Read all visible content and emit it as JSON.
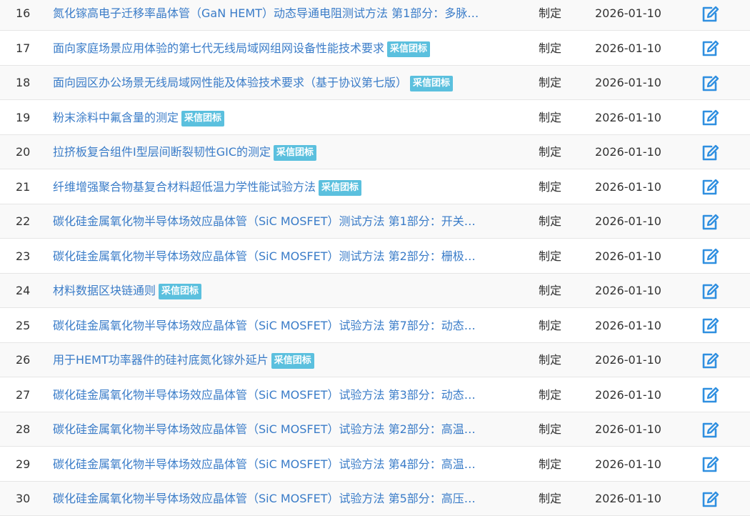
{
  "badge_label": "采信团标",
  "icon": {
    "edit": "edit-icon",
    "color": "#2f8fe0"
  },
  "rows": [
    {
      "num": "16",
      "title": "氮化镓高电子迁移率晶体管（GaN HEMT）动态导通电阻测试方法 第1部分：多脉…",
      "badge": false,
      "type": "制定",
      "date": "2026-01-10"
    },
    {
      "num": "17",
      "title": "面向家庭场景应用体验的第七代无线局域网组网设备性能技术要求",
      "badge": true,
      "type": "制定",
      "date": "2026-01-10"
    },
    {
      "num": "18",
      "title": "面向园区办公场景无线局域网性能及体验技术要求（基于协议第七版）",
      "badge": true,
      "type": "制定",
      "date": "2026-01-10"
    },
    {
      "num": "19",
      "title": "粉末涂料中氟含量的测定",
      "badge": true,
      "type": "制定",
      "date": "2026-01-10"
    },
    {
      "num": "20",
      "title": "拉挤板复合组件I型层间断裂韧性GIC的测定",
      "badge": true,
      "type": "制定",
      "date": "2026-01-10"
    },
    {
      "num": "21",
      "title": "纤维增强聚合物基复合材料超低温力学性能试验方法",
      "badge": true,
      "type": "制定",
      "date": "2026-01-10"
    },
    {
      "num": "22",
      "title": "碳化硅金属氧化物半导体场效应晶体管（SiC MOSFET）测试方法 第1部分：开关…",
      "badge": false,
      "type": "制定",
      "date": "2026-01-10"
    },
    {
      "num": "23",
      "title": "碳化硅金属氧化物半导体场效应晶体管（SiC MOSFET）测试方法 第2部分：栅极…",
      "badge": false,
      "type": "制定",
      "date": "2026-01-10"
    },
    {
      "num": "24",
      "title": "材料数据区块链通则",
      "badge": true,
      "type": "制定",
      "date": "2026-01-10"
    },
    {
      "num": "25",
      "title": "碳化硅金属氧化物半导体场效应晶体管（SiC MOSFET）试验方法 第7部分：动态…",
      "badge": false,
      "type": "制定",
      "date": "2026-01-10"
    },
    {
      "num": "26",
      "title": "用于HEMT功率器件的硅衬底氮化镓外延片",
      "badge": true,
      "type": "制定",
      "date": "2026-01-10"
    },
    {
      "num": "27",
      "title": "碳化硅金属氧化物半导体场效应晶体管（SiC MOSFET）试验方法 第3部分：动态…",
      "badge": false,
      "type": "制定",
      "date": "2026-01-10"
    },
    {
      "num": "28",
      "title": "碳化硅金属氧化物半导体场效应晶体管（SiC MOSFET）试验方法 第2部分：高温…",
      "badge": false,
      "type": "制定",
      "date": "2026-01-10"
    },
    {
      "num": "29",
      "title": "碳化硅金属氧化物半导体场效应晶体管（SiC MOSFET）试验方法 第4部分：高温…",
      "badge": false,
      "type": "制定",
      "date": "2026-01-10"
    },
    {
      "num": "30",
      "title": "碳化硅金属氧化物半导体场效应晶体管（SiC MOSFET）试验方法 第5部分：高压…",
      "badge": false,
      "type": "制定",
      "date": "2026-01-10"
    }
  ]
}
